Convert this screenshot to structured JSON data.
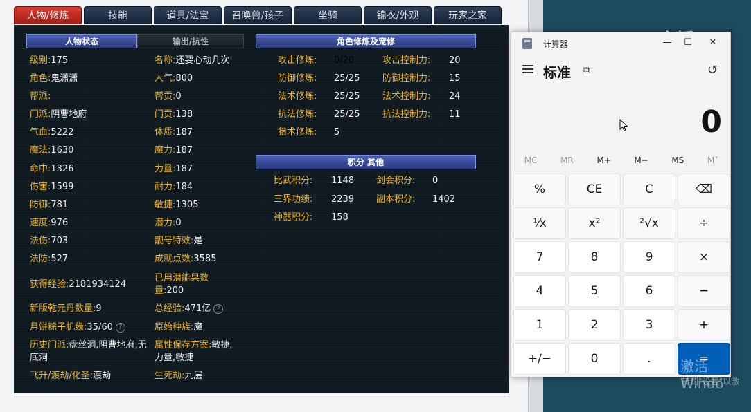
{
  "tabs": [
    "人物/修炼",
    "技能",
    "道具/法宝",
    "召唤兽/孩子",
    "坐骑",
    "锦衣/外观",
    "玩家之家"
  ],
  "status_header": "人物状态",
  "output_header": "输出/抗性",
  "cultivation_header": "角色修炼及宠修",
  "points_header": "积分 其他",
  "left_stats": [
    {
      "label": "级别:",
      "value": "175"
    },
    {
      "label": "角色:",
      "value": "鬼潇潇"
    },
    {
      "label": "帮派:",
      "value": ""
    },
    {
      "label": "门派:",
      "value": "阴曹地府"
    },
    {
      "label": "气血:",
      "value": "5222"
    },
    {
      "label": "魔法:",
      "value": "1630"
    },
    {
      "label": "命中:",
      "value": "1326"
    },
    {
      "label": "伤害:",
      "value": "1599"
    },
    {
      "label": "防御:",
      "value": "781"
    },
    {
      "label": "速度:",
      "value": "976"
    },
    {
      "label": "法伤:",
      "value": "703"
    },
    {
      "label": "法防:",
      "value": "527"
    },
    {
      "label": "获得经验:",
      "value": "2181934124"
    },
    {
      "label": "新版乾元丹数量:",
      "value": "9"
    },
    {
      "label": "月饼粽子机缘:",
      "value": "35/60"
    },
    {
      "label": "历史门派:",
      "value": "盘丝洞,阴曹地府,无底洞"
    },
    {
      "label": "飞升/渡劫/化圣:",
      "value": "渡劫"
    }
  ],
  "right_stats": [
    {
      "label": "名称:",
      "value": "还要心动几次"
    },
    {
      "label": "人气:",
      "value": "800"
    },
    {
      "label": "帮贡:",
      "value": "0"
    },
    {
      "label": "门贡:",
      "value": "138"
    },
    {
      "label": "体质:",
      "value": "187"
    },
    {
      "label": "魔力:",
      "value": "187"
    },
    {
      "label": "力量:",
      "value": "187"
    },
    {
      "label": "耐力:",
      "value": "184"
    },
    {
      "label": "敏捷:",
      "value": "1305"
    },
    {
      "label": "潜力:",
      "value": "0"
    },
    {
      "label": "靓号特效:",
      "value": "是"
    },
    {
      "label": "成就点数:",
      "value": "3585"
    },
    {
      "label": "已用潜能果数量:",
      "value": "200"
    },
    {
      "label": "总经验:",
      "value": "471亿"
    },
    {
      "label": "原始种族:",
      "value": "魔"
    },
    {
      "label": "属性保存方案:",
      "value": "敏捷,力量,敏捷"
    },
    {
      "label": "生死劫:",
      "value": "九层"
    }
  ],
  "cultivation": [
    {
      "label": "攻击修炼:",
      "value": "0/20"
    },
    {
      "label": "防御修炼:",
      "value": "25/25"
    },
    {
      "label": "法术修炼:",
      "value": "25/25"
    },
    {
      "label": "抗法修炼:",
      "value": "25/25"
    },
    {
      "label": "猎术修炼:",
      "value": "5"
    }
  ],
  "control": [
    {
      "label": "攻击控制力:",
      "value": "20"
    },
    {
      "label": "防御控制力:",
      "value": "15"
    },
    {
      "label": "法术控制力:",
      "value": "24"
    },
    {
      "label": "抗法控制力:",
      "value": "11"
    }
  ],
  "points_left": [
    {
      "label": "比武积分:",
      "value": "1148"
    },
    {
      "label": "三界功绩:",
      "value": "2239"
    },
    {
      "label": "神器积分:",
      "value": "158"
    }
  ],
  "points_right": [
    {
      "label": "剑会积分:",
      "value": "0"
    },
    {
      "label": "副本积分:",
      "value": "1402"
    }
  ],
  "calculator": {
    "title": "计算器",
    "mode": "标准",
    "display": "0",
    "memory": [
      "MC",
      "MR",
      "M+",
      "M−",
      "MS",
      "M˅"
    ],
    "keys": [
      "%",
      "CE",
      "C",
      "⌫",
      "⅟x",
      "x²",
      "²√x",
      "÷",
      "7",
      "8",
      "9",
      "×",
      "4",
      "5",
      "6",
      "−",
      "1",
      "2",
      "3",
      "+",
      "+/−",
      "0",
      ".",
      "="
    ]
  },
  "watermark": "CC直播",
  "activation": {
    "title": "激活 Windo",
    "subtitle": "转到\"设置\"以激"
  }
}
